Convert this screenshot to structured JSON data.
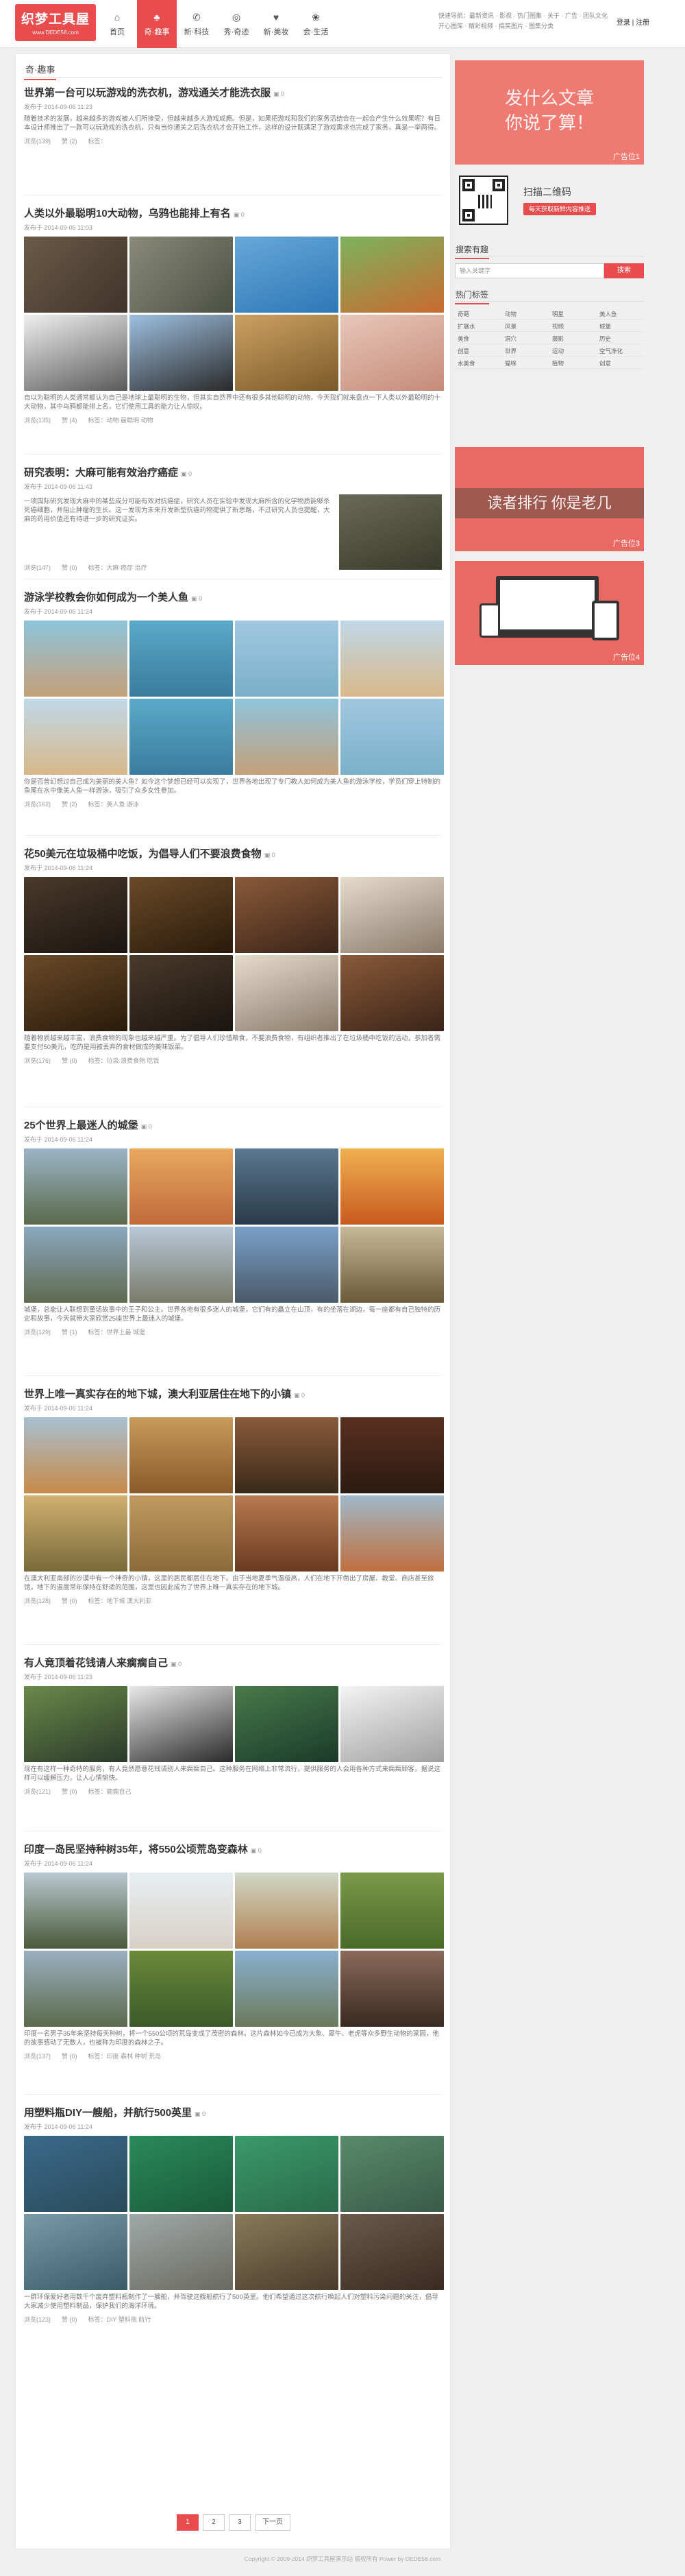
{
  "header": {
    "logo_title": "织梦工具屋",
    "logo_sub": "www.DEDE58.com",
    "nav": [
      {
        "icon": "⌂",
        "label": "首页"
      },
      {
        "icon": "♣",
        "label": "奇·趣事"
      },
      {
        "icon": "✆",
        "label": "新·科技"
      },
      {
        "icon": "◎",
        "label": "秀·奇迹"
      },
      {
        "icon": "♥",
        "label": "新·美妆"
      },
      {
        "icon": "❀",
        "label": "会·生活"
      }
    ],
    "links_line1": "快速导航：最新资讯 · 影视 · 热门图集 · 关于 · 广告 · 团队文化",
    "links_line2": "开心图库 · 精彩视频 · 搞笑图片 · 图集分类",
    "login": "登录 | 注册"
  },
  "main": {
    "section_title": "奇·趣事",
    "posts": [
      {
        "title": "世界第一台可以玩游戏的洗衣机，游戏通关才能洗衣服",
        "comments": "0",
        "date": "发布于 2014-09-06 11:23",
        "excerpt": "随着技术的发展，越来越多的游戏被人们所接受，但越来越多人游戏成瘾。但是，如果把游戏和我们的家务活结合在一起会产生什么效果呢？有日本设计师推出了一款可以玩游戏的洗衣机，只有当你通关之后洗衣机才会开始工作，这样的设计既满足了游戏需求也完成了家务，真是一举两得。",
        "views": "浏览(139)",
        "likes": "赞 (2)",
        "tags": "标签："
      },
      {
        "title": "人类以外最聪明10大动物，乌鸦也能排上有名",
        "comments": "0",
        "date": "发布于 2014-09-06 11:03",
        "excerpt": "自以为聪明的人类通常都认为自己是地球上最聪明的生物，但其实自然界中还有很多其他聪明的动物，今天我们就来盘点一下人类以外最聪明的十大动物，其中乌鸦都能排上名，它们使用工具的能力让人惊叹。",
        "views": "浏览(135)",
        "likes": "赞 (4)",
        "tags": "标签：动物 最聪明 动物"
      },
      {
        "title": "研究表明：大麻可能有效治疗癌症",
        "comments": "0",
        "date": "发布于 2014-09-06 11:43",
        "excerpt": "一项国际研究发现大麻中的某些成分可能有效对抗癌症，研究人员在实验中发现大麻所含的化学物质能够杀死癌细胞，并阻止肿瘤的生长。这一发现为未来开发新型抗癌药物提供了新思路，不过研究人员也提醒，大麻的药用价值还有待进一步的研究证实。",
        "views": "浏览(147)",
        "likes": "赞 (0)",
        "tags": "标签：大麻 癌症 治疗"
      },
      {
        "title": "游泳学校教会你如何成为一个美人鱼",
        "comments": "0",
        "date": "发布于 2014-09-06 11:24",
        "excerpt": "你是否曾幻想过自己成为美丽的美人鱼？如今这个梦想已经可以实现了，世界各地出现了专门教人如何成为美人鱼的游泳学校，学员们穿上特制的鱼尾在水中像美人鱼一样游泳，吸引了众多女性参加。",
        "views": "浏览(162)",
        "likes": "赞 (2)",
        "tags": "标签：美人鱼 游泳"
      },
      {
        "title": "花50美元在垃圾桶中吃饭，为倡导人们不要浪费食物",
        "comments": "0",
        "date": "发布于 2014-09-06 11:24",
        "excerpt": "随着物质越来越丰富，浪费食物的现象也越来越严重。为了倡导人们珍惜粮食，不要浪费食物，有组织者推出了在垃圾桶中吃饭的活动，参加者需要支付50美元，吃的是用被丢弃的食材做成的美味饭菜。",
        "views": "浏览(176)",
        "likes": "赞 (0)",
        "tags": "标签：垃圾 浪费食物 吃饭"
      },
      {
        "title": "25个世界上最迷人的城堡",
        "comments": "0",
        "date": "发布于 2014-09-06 11:24",
        "excerpt": "城堡，总能让人联想到童话故事中的王子和公主。世界各地有很多迷人的城堡，它们有的矗立在山顶，有的坐落在湖边，每一座都有自己独特的历史和故事，今天就带大家欣赏25座世界上最迷人的城堡。",
        "views": "浏览(129)",
        "likes": "赞 (1)",
        "tags": "标签：世界上最 城堡"
      },
      {
        "title": "世界上唯一真实存在的地下城，澳大利亚居住在地下的小镇",
        "comments": "0",
        "date": "发布于 2014-09-06 11:24",
        "excerpt": "在澳大利亚南部的沙漠中有一个神奇的小镇，这里的居民都居住在地下。由于当地夏季气温极高，人们在地下开凿出了房屋、教堂、商店甚至旅馆，地下的温度常年保持在舒适的范围，这里也因此成为了世界上唯一真实存在的地下城。",
        "views": "浏览(128)",
        "likes": "赞 (0)",
        "tags": "标签：地下城 澳大利亚"
      },
      {
        "title": "有人竟顶着花钱请人来瘸瘸自己",
        "comments": "0",
        "date": "发布于 2014-09-06 11:23",
        "excerpt": "现在有这样一种奇特的服务，有人竟然愿意花钱请别人来瘸瘸自己。这种服务在网络上非常流行，提供服务的人会用各种方式来瘸瘸顾客，据说这样可以缓解压力，让人心情愉快。",
        "views": "浏览(121)",
        "likes": "赞 (0)",
        "tags": "标签：瘸瘸自己"
      },
      {
        "title": "印度一岛民坚持种树35年，将550公顷荒岛变森林",
        "comments": "0",
        "date": "发布于 2014-09-06 11:24",
        "excerpt": "印度一名男子35年来坚持每天种树，将一个550公顷的荒岛变成了茂密的森林。这片森林如今已成为大象、犀牛、老虎等众多野生动物的家园，他的故事感动了无数人，也被称为印度的森林之子。",
        "views": "浏览(137)",
        "likes": "赞 (0)",
        "tags": "标签：印度 森林 种树 荒岛"
      },
      {
        "title": "用塑料瓶DIY一艘船，并航行500英里",
        "comments": "0",
        "date": "发布于 2014-09-06 11:24",
        "excerpt": "一群环保爱好者用数千个废弃塑料瓶制作了一艘船，并驾驶这艘船航行了500英里。他们希望通过这次航行唤起人们对塑料污染问题的关注，倡导大家减少使用塑料制品，保护我们的海洋环境。",
        "views": "浏览(123)",
        "likes": "赞 (0)",
        "tags": "标签：DIY 塑料瓶 航行"
      }
    ]
  },
  "pagination": [
    "1",
    "2",
    "3",
    "下一页"
  ],
  "sidebar": {
    "ad1_text": "发什么文章\n你说了算！",
    "ad1_label": "广告位1",
    "qr_title": "扫描二维码",
    "qr_button": "每天获取新鲜内容推送",
    "search_heading": "搜索有趣",
    "search_placeholder": "输入关键字",
    "search_button": "搜索",
    "tags_heading": "热门标签",
    "tags": [
      "奇葩",
      "动物",
      "明星",
      "美人鱼",
      "扩展水",
      "风景",
      "视频",
      "城堡",
      "美食",
      "洞穴",
      "摄影",
      "历史",
      "创意",
      "世界",
      "运动",
      "空气净化",
      "水美食",
      "猫咪",
      "植物",
      "创意"
    ],
    "ad3_text": "读者排行   你是老几",
    "ad3_label": "广告位3",
    "ad4_label": "广告位4"
  },
  "footer": {
    "text": "Copyright © 2009-2014 织梦工具屋演示站 版权所有 Power by DEDE58.com"
  }
}
